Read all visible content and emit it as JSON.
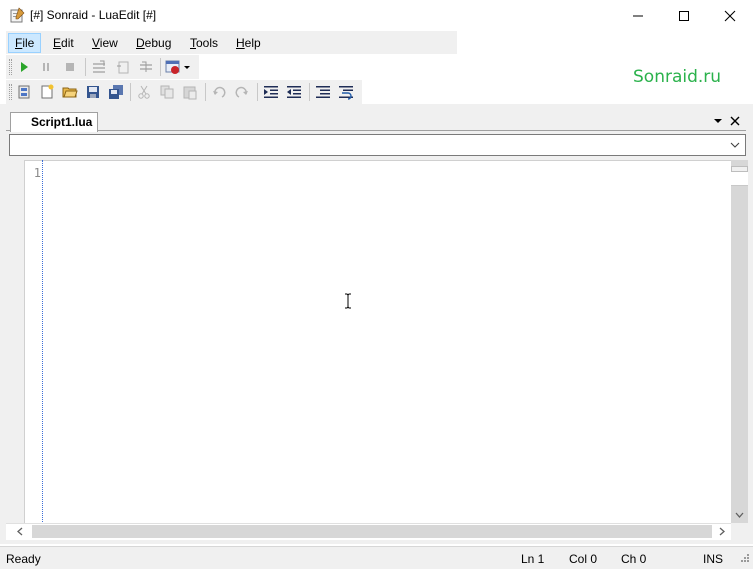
{
  "window": {
    "title": "[#] Sonraid - LuaEdit [#]",
    "controls": [
      "minimize",
      "maximize",
      "close"
    ]
  },
  "menu": {
    "items": [
      {
        "label": "File",
        "mnemonic": "F",
        "rest": "ile",
        "active": true
      },
      {
        "label": "Edit",
        "mnemonic": "E",
        "rest": "dit"
      },
      {
        "label": "View",
        "mnemonic": "V",
        "rest": "iew"
      },
      {
        "label": "Debug",
        "mnemonic": "D",
        "rest": "ebug"
      },
      {
        "label": "Tools",
        "mnemonic": "T",
        "rest": "ools"
      },
      {
        "label": "Help",
        "mnemonic": "H",
        "rest": "elp"
      }
    ]
  },
  "toolbars": {
    "debug": [
      "run-icon",
      "pause-icon",
      "stop-icon",
      "step-into-icon",
      "step-over-icon",
      "step-out-icon",
      "breakpoint-dropdown-icon"
    ],
    "standard": [
      "new-project-icon",
      "new-file-icon",
      "open-icon",
      "save-icon",
      "save-all-icon",
      "cut-icon",
      "copy-icon",
      "paste-icon",
      "undo-icon",
      "redo-icon",
      "indent-icon",
      "unindent-icon",
      "comment-icon",
      "uncomment-icon"
    ]
  },
  "brand": {
    "text": "Sonraid.ru",
    "color": "#2bb24c"
  },
  "editor": {
    "tab_label": "Script1.lua",
    "function_combo_value": "",
    "line_numbers": [
      "1"
    ],
    "content": ""
  },
  "status": {
    "message": "Ready",
    "line": "Ln 1",
    "col": "Col 0",
    "ch": "Ch 0",
    "mode": "INS"
  }
}
